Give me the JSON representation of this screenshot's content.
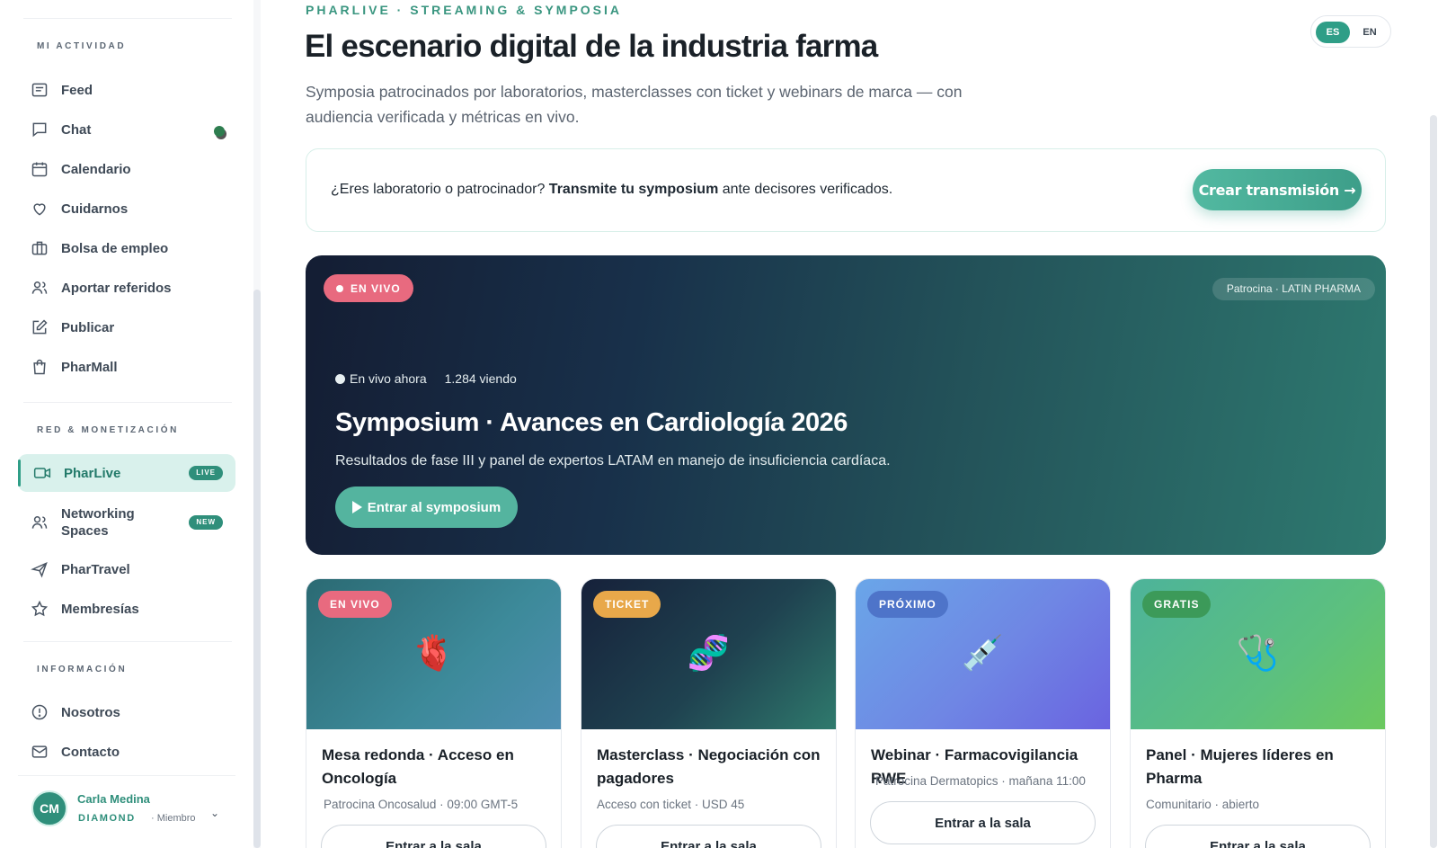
{
  "sidebar": {
    "section_activity": "MI ACTIVIDAD",
    "section_network": "RED & MONETIZACIÓN",
    "section_info": "INFORMACIÓN",
    "items": [
      {
        "label": "Feed",
        "icon": "feed-icon"
      },
      {
        "label": "Chat",
        "icon": "chat-icon"
      },
      {
        "label": "Calendario",
        "icon": "calendar-icon"
      },
      {
        "label": "Cuidarnos",
        "icon": "heart-icon"
      },
      {
        "label": "Bolsa de empleo",
        "icon": "briefcase-icon"
      },
      {
        "label": "Aportar referidos",
        "icon": "users-icon"
      },
      {
        "label": "Publicar",
        "icon": "edit-icon"
      },
      {
        "label": "PharMall",
        "icon": "shopping-bag-icon"
      },
      {
        "label": "PharLive",
        "icon": "video-icon",
        "badge": "LIVE",
        "active": true
      },
      {
        "label": "Networking Spaces",
        "icon": "users-icon",
        "badge": "NEW"
      },
      {
        "label": "PharTravel",
        "icon": "plane-icon"
      },
      {
        "label": "Membresías",
        "icon": "star-icon"
      },
      {
        "label": "Nosotros",
        "icon": "info-icon"
      },
      {
        "label": "Contacto",
        "icon": "mail-icon"
      }
    ],
    "user": {
      "initials": "CM",
      "name": "Carla Medina",
      "tier": "DIAMOND",
      "role": "· Miembro"
    }
  },
  "header": {
    "eyebrow": "PHARLIVE · STREAMING & SYMPOSIA",
    "title": "El escenario digital de la industria farma",
    "subtitle": "Symposia patrocinados por laboratorios, masterclasses con ticket y webinars de marca — con audiencia verificada y métricas en vivo.",
    "lang": {
      "es": "ES",
      "en": "EN",
      "selected": "ES"
    }
  },
  "cta": {
    "text_before": "¿Eres laboratorio o patrocinador? ",
    "text_bold": "Transmite tu symposium",
    "text_after": " ante decisores verificados.",
    "button": "Crear transmisión →"
  },
  "hero": {
    "badge": "EN VIVO",
    "sponsor": "Patrocina · LATIN PHARMA",
    "status": "En vivo ahora",
    "viewers": "1.284 viendo",
    "title": "Symposium · Avances en Cardiología 2026",
    "description": "Resultados de fase III y panel de expertos LATAM en manejo de insuficiencia cardíaca.",
    "button": "Entrar al symposium"
  },
  "cards": [
    {
      "badge": "EN VIVO",
      "emoji": "🫀",
      "title": "Mesa redonda · Acceso en Oncología",
      "meta": "Patrocina Oncosalud · 09:00 GMT-5",
      "button": "Entrar a la sala"
    },
    {
      "badge": "TICKET",
      "emoji": "🧬",
      "title": "Masterclass · Negociación con pagadores",
      "meta": "Acceso con ticket · USD 45",
      "button": "Entrar a la sala"
    },
    {
      "badge": "PRÓXIMO",
      "emoji": "💉",
      "title": "Webinar · Farmacovigilancia RWE",
      "meta": "Patrocina Dermatopics · mañana 11:00",
      "button": "Entrar a la sala"
    },
    {
      "badge": "GRATIS",
      "emoji": "🩺",
      "title": "Panel · Mujeres líderes en Pharma",
      "meta": "Comunitario · abierto",
      "button": "Entrar a la sala"
    }
  ],
  "colors": {
    "accent": "#2f9e87",
    "live": "#e86a7f",
    "ticket": "#e8a84a",
    "next": "#4e74c9",
    "free": "#3c9a59"
  }
}
